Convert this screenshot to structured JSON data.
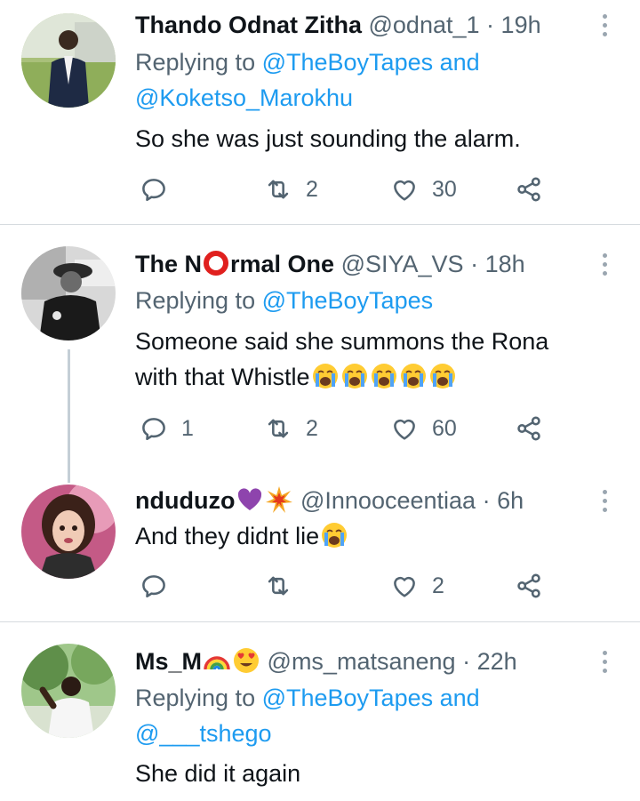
{
  "tweets": [
    {
      "name": "Thando Odnat Zitha",
      "handle": "@odnat_1",
      "dot": "·",
      "time": "19h",
      "replying_prefix": "Replying to ",
      "reply_mention_1": "@TheBoyTapes and",
      "reply_mention_2": "@Koketso_Marokhu",
      "text": "So she was just sounding the alarm.",
      "retweets": "2",
      "likes": "30"
    },
    {
      "name_part1": "The N",
      "name_part2": "rmal One",
      "handle": "@SIYA_VS",
      "dot": "·",
      "time": "18h",
      "replying_prefix": "Replying to ",
      "reply_mention_1": "@TheBoyTapes",
      "text_line1": "Someone said she summons the Rona",
      "text_line2": "with that Whistle",
      "replies": "1",
      "retweets": "2",
      "likes": "60"
    },
    {
      "name": "nduduzo",
      "handle": "@Innooceentiaa",
      "dot": "·",
      "time": "6h",
      "text": "And they didnt lie",
      "likes": "2"
    },
    {
      "name": "Ms_M",
      "handle": "@ms_matsaneng",
      "dot": "·",
      "time": "22h",
      "replying_prefix": "Replying to ",
      "reply_mention_1": "@TheBoyTapes and",
      "reply_mention_2": "@___tshego",
      "text": "She did it again"
    }
  ],
  "icons": {
    "reply": "reply-icon",
    "retweet": "retweet-icon",
    "like": "heart-icon",
    "share": "share-icon",
    "more": "more-icon"
  },
  "colors": {
    "link": "#1d9bf0",
    "secondary": "#536471",
    "text": "#0f1419",
    "divider": "#d6dbdf"
  }
}
